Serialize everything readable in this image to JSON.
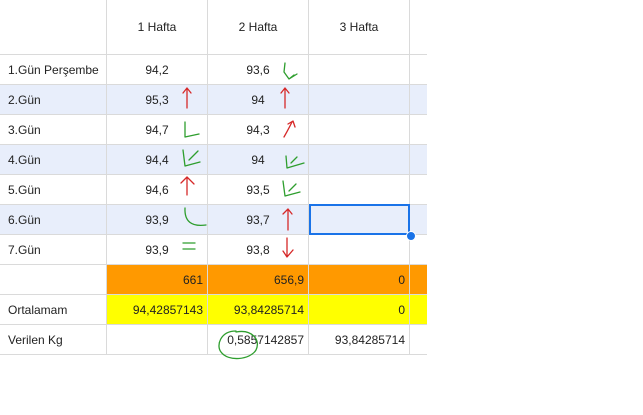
{
  "colors": {
    "band_blue": "#e8eefb",
    "orange": "#ff9900",
    "yellow": "#ffff00",
    "selection": "#1a73e8",
    "ink_green": "#2e9e2e",
    "ink_red": "#d62828"
  },
  "headers": [
    "",
    "1 Hafta",
    "2 Hafta",
    "3 Hafta"
  ],
  "days": [
    {
      "label": "1.Gün Perşembe",
      "w1": "94,2",
      "w2": "93,6",
      "w3": "",
      "m1": "",
      "m2": "check-green-icon"
    },
    {
      "label": "2.Gün",
      "w1": "95,3",
      "w2": "94",
      "w3": "",
      "m1": "up-arrow-red-icon",
      "m2": "up-arrow-red-icon"
    },
    {
      "label": "3.Gün",
      "w1": "94,7",
      "w2": "94,3",
      "w3": "",
      "m1": "check-green-icon",
      "m2": "up-arrow-red-icon"
    },
    {
      "label": "4.Gün",
      "w1": "94,4",
      "w2": "94",
      "w3": "",
      "m1": "check-green-icon",
      "m2": "check-green-icon"
    },
    {
      "label": "5.Gün",
      "w1": "94,6",
      "w2": "93,5",
      "w3": "",
      "m1": "up-arrow-red-icon",
      "m2": "check-green-icon"
    },
    {
      "label": "6.Gün",
      "w1": "93,9",
      "w2": "93,7",
      "w3": "",
      "m1": "check-green-icon",
      "m2": "up-arrow-red-icon"
    },
    {
      "label": "7.Gün",
      "w1": "93,9",
      "w2": "93,8",
      "w3": "",
      "m1": "equals-green-icon",
      "m2": "down-arrow-red-icon"
    }
  ],
  "totals": {
    "label": "",
    "w1": "661",
    "w2": "656,9",
    "w3": "0"
  },
  "averages": {
    "label": "Ortalamam",
    "w1": "94,42857143",
    "w2": "93,84285714",
    "w3": "0"
  },
  "given": {
    "label": "Verilen Kg",
    "w1": "",
    "w2": "0,5857142857",
    "w3": "93,84285714"
  },
  "selected_cell": {
    "row": "6.Gün",
    "column": "3 Hafta"
  },
  "annotations": {
    "circled_value": "0,5857142857"
  }
}
